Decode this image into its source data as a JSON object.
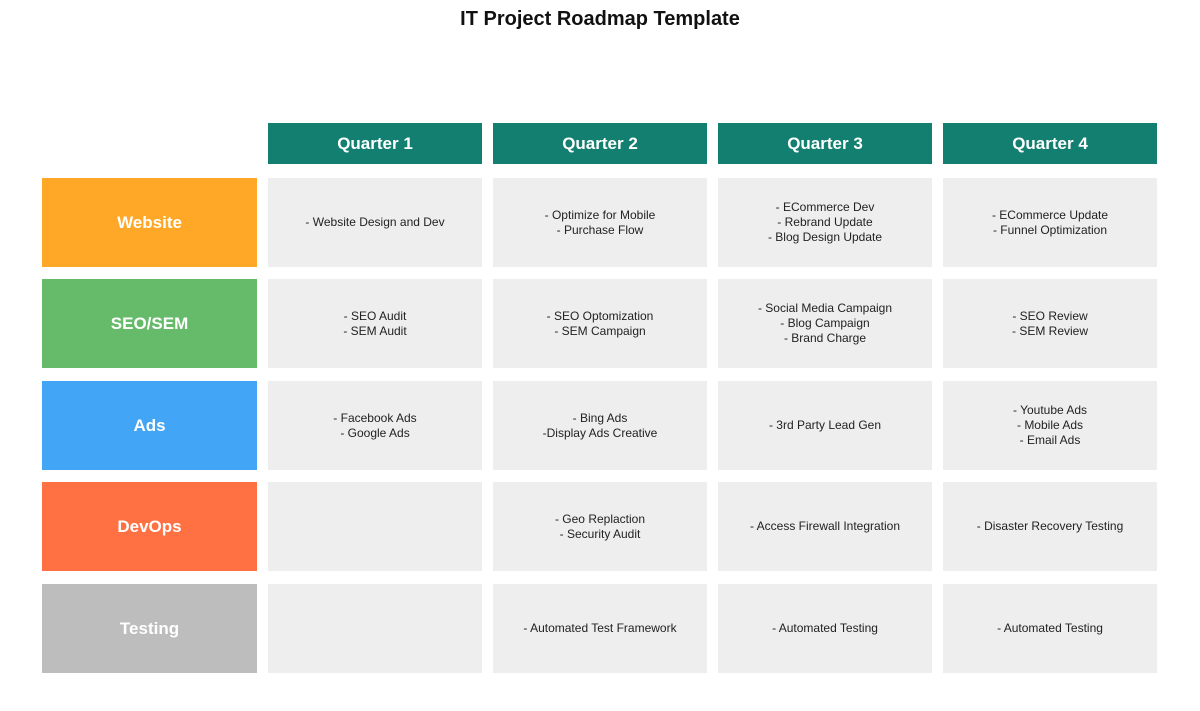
{
  "title": "IT Project Roadmap Template",
  "quarters": [
    "Quarter 1",
    "Quarter 2",
    "Quarter 3",
    "Quarter 4"
  ],
  "rows": [
    {
      "label": "Website",
      "color": "#FFA726",
      "cells": [
        [
          "- Website Design and Dev"
        ],
        [
          "- Optimize for Mobile",
          "- Purchase Flow"
        ],
        [
          "- ECommerce Dev",
          "- Rebrand Update",
          "- Blog Design Update"
        ],
        [
          "- ECommerce Update",
          "- Funnel Optimization"
        ]
      ]
    },
    {
      "label": "SEO/SEM",
      "color": "#66BB6A",
      "cells": [
        [
          "- SEO Audit",
          "- SEM Audit"
        ],
        [
          "- SEO Optomization",
          "- SEM Campaign"
        ],
        [
          "- Social Media Campaign",
          "- Blog Campaign",
          "- Brand Charge"
        ],
        [
          "- SEO Review",
          "- SEM Review"
        ]
      ]
    },
    {
      "label": "Ads",
      "color": "#42A5F5",
      "cells": [
        [
          "- Facebook Ads",
          "- Google Ads"
        ],
        [
          "- Bing Ads",
          "-Display Ads Creative"
        ],
        [
          "- 3rd Party Lead Gen"
        ],
        [
          "- Youtube Ads",
          "- Mobile Ads",
          "- Email Ads"
        ]
      ]
    },
    {
      "label": "DevOps",
      "color": "#FF7043",
      "cells": [
        [],
        [
          "- Geo Replaction",
          "- Security Audit"
        ],
        [
          "- Access Firewall Integration"
        ],
        [
          "- Disaster Recovery Testing"
        ]
      ]
    },
    {
      "label": "Testing",
      "color": "#BDBDBD",
      "cells": [
        [],
        [
          "- Automated Test Framework"
        ],
        [
          "- Automated Testing"
        ],
        [
          "- Automated Testing"
        ]
      ]
    }
  ],
  "colors": {
    "header": "#137F71",
    "cell_bg": "#EEEEEE"
  }
}
